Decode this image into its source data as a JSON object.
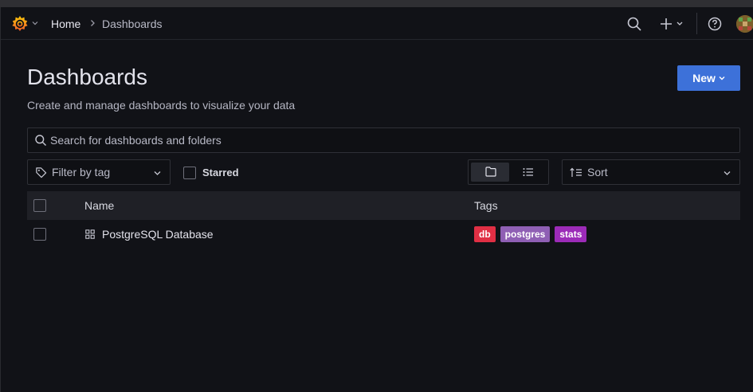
{
  "breadcrumb": {
    "home": "Home",
    "current": "Dashboards"
  },
  "page": {
    "title": "Dashboards",
    "subtitle": "Create and manage dashboards to visualize your data",
    "new_button": "New"
  },
  "search": {
    "placeholder": "Search for dashboards and folders",
    "value": ""
  },
  "filters": {
    "tag_placeholder": "Filter by tag",
    "starred_label": "Starred",
    "starred_checked": false,
    "view_mode": "folder",
    "sort_label": "Sort"
  },
  "table": {
    "columns": {
      "name": "Name",
      "tags": "Tags"
    },
    "rows": [
      {
        "name": "PostgreSQL Database",
        "type": "dashboard",
        "tags": [
          {
            "label": "db",
            "color": "#e02f44"
          },
          {
            "label": "postgres",
            "color": "#8f5fb4"
          },
          {
            "label": "stats",
            "color": "#9c2bb8"
          }
        ]
      }
    ]
  },
  "colors": {
    "background": "#111217",
    "primary_button": "#3d71d9",
    "logo": "#f46800"
  }
}
